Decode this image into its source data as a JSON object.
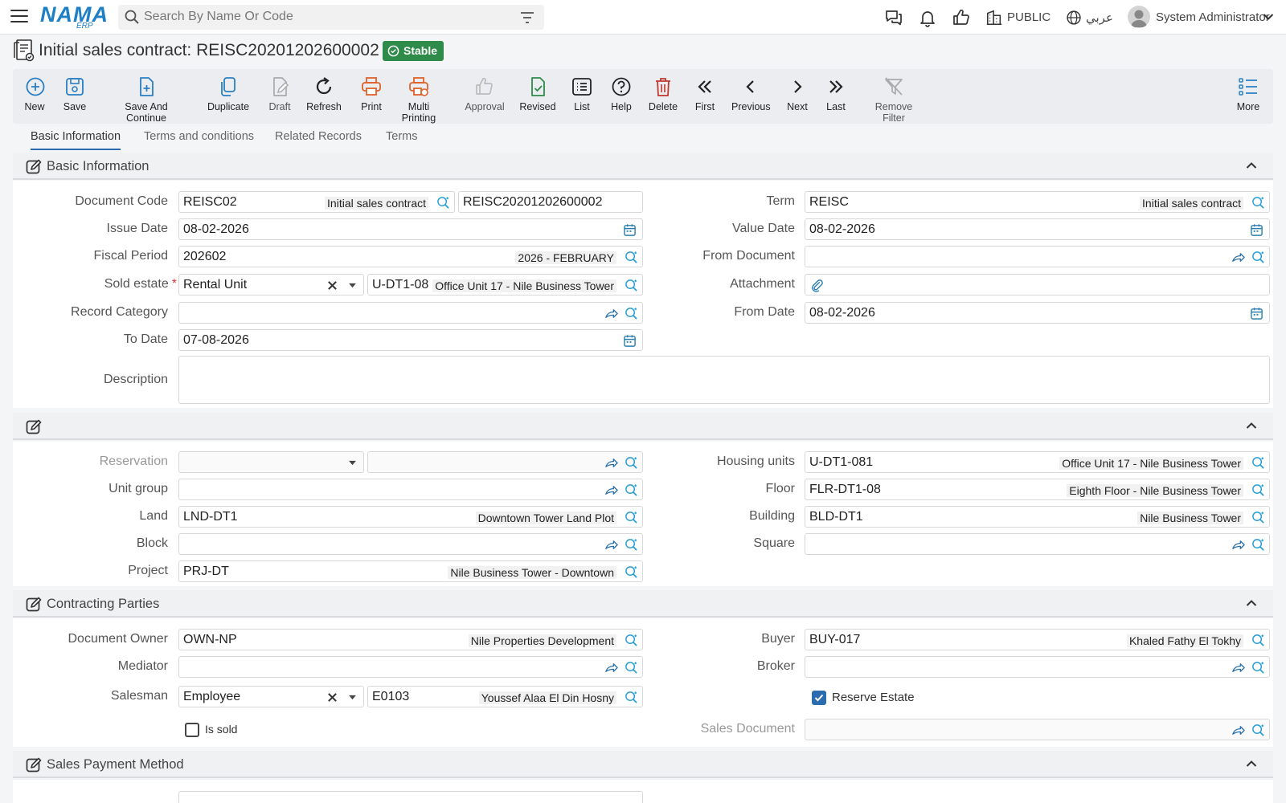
{
  "header": {
    "logo_text": "NAMA",
    "logo_sub": "ERP",
    "search_placeholder": "Search By Name Or Code",
    "public_label": "PUBLIC",
    "lang_label": "عربي",
    "user_name": "System Administrator"
  },
  "title": {
    "text": "Initial sales contract: REISC20201202600002",
    "status": "Stable"
  },
  "toolbar": {
    "new": "New",
    "save": "Save",
    "save_continue": "Save And Continue",
    "duplicate": "Duplicate",
    "draft": "Draft",
    "refresh": "Refresh",
    "print": "Print",
    "multi_printing": "Multi Printing",
    "approval": "Approval",
    "revised": "Revised",
    "list": "List",
    "help": "Help",
    "delete": "Delete",
    "first": "First",
    "previous": "Previous",
    "next": "Next",
    "last": "Last",
    "remove_filter": "Remove Filter",
    "more": "More"
  },
  "tabs": [
    "Basic Information",
    "Terms and conditions",
    "Related Records",
    "Terms"
  ],
  "sections": {
    "basic": "Basic Information",
    "unnamed": "",
    "parties": "Contracting Parties",
    "payment": "Sales Payment Method"
  },
  "basic": {
    "document_code": {
      "label": "Document Code",
      "code": "REISC02",
      "desc": "Initial sales contract",
      "number": "REISC20201202600002"
    },
    "term": {
      "label": "Term",
      "code": "REISC",
      "desc": "Initial sales contract"
    },
    "issue_date": {
      "label": "Issue Date",
      "value": "08-02-2026"
    },
    "value_date": {
      "label": "Value Date",
      "value": "08-02-2026"
    },
    "fiscal_period": {
      "label": "Fiscal Period",
      "value": "202602",
      "desc": "2026 - FEBRUARY"
    },
    "from_document": {
      "label": "From Document",
      "value": ""
    },
    "sold_estate": {
      "label": "Sold estate",
      "type": "Rental Unit",
      "code": "U-DT1-08",
      "desc": "Office Unit 17 - Nile Business Tower"
    },
    "attachment": {
      "label": "Attachment"
    },
    "record_category": {
      "label": "Record Category",
      "value": ""
    },
    "from_date": {
      "label": "From Date",
      "value": "08-02-2026"
    },
    "to_date": {
      "label": "To Date",
      "value": "07-08-2026"
    },
    "description": {
      "label": "Description",
      "value": ""
    }
  },
  "estate": {
    "reservation": {
      "label": "Reservation"
    },
    "housing_units": {
      "label": "Housing units",
      "code": "U-DT1-081",
      "desc": "Office Unit 17 - Nile Business Tower"
    },
    "unit_group": {
      "label": "Unit group"
    },
    "floor": {
      "label": "Floor",
      "code": "FLR-DT1-08",
      "desc": "Eighth Floor - Nile Business Tower"
    },
    "land": {
      "label": "Land",
      "code": "LND-DT1",
      "desc": "Downtown Tower Land Plot"
    },
    "building": {
      "label": "Building",
      "code": "BLD-DT1",
      "desc": "Nile Business Tower"
    },
    "block": {
      "label": "Block"
    },
    "square": {
      "label": "Square"
    },
    "project": {
      "label": "Project",
      "code": "PRJ-DT",
      "desc": "Nile Business Tower - Downtown"
    }
  },
  "parties": {
    "document_owner": {
      "label": "Document Owner",
      "code": "OWN-NP",
      "desc": "Nile Properties Development"
    },
    "buyer": {
      "label": "Buyer",
      "code": "BUY-017",
      "desc": "Khaled Fathy El Tokhy"
    },
    "mediator": {
      "label": "Mediator"
    },
    "broker": {
      "label": "Broker"
    },
    "salesman": {
      "label": "Salesman",
      "type": "Employee",
      "code": "E0103",
      "desc": "Youssef Alaa El Din Hosny"
    },
    "reserve_estate": {
      "label": "Reserve Estate",
      "checked": true
    },
    "is_sold": {
      "label": "Is sold",
      "checked": false
    },
    "sales_document": {
      "label": "Sales Document"
    }
  },
  "colors": {
    "accent": "#2b6cb0",
    "stable": "#2e8b4a",
    "print": "#e0612a",
    "delete": "#c0392b",
    "revised": "#2e8b4a",
    "lookup": "#2a9fd6"
  }
}
